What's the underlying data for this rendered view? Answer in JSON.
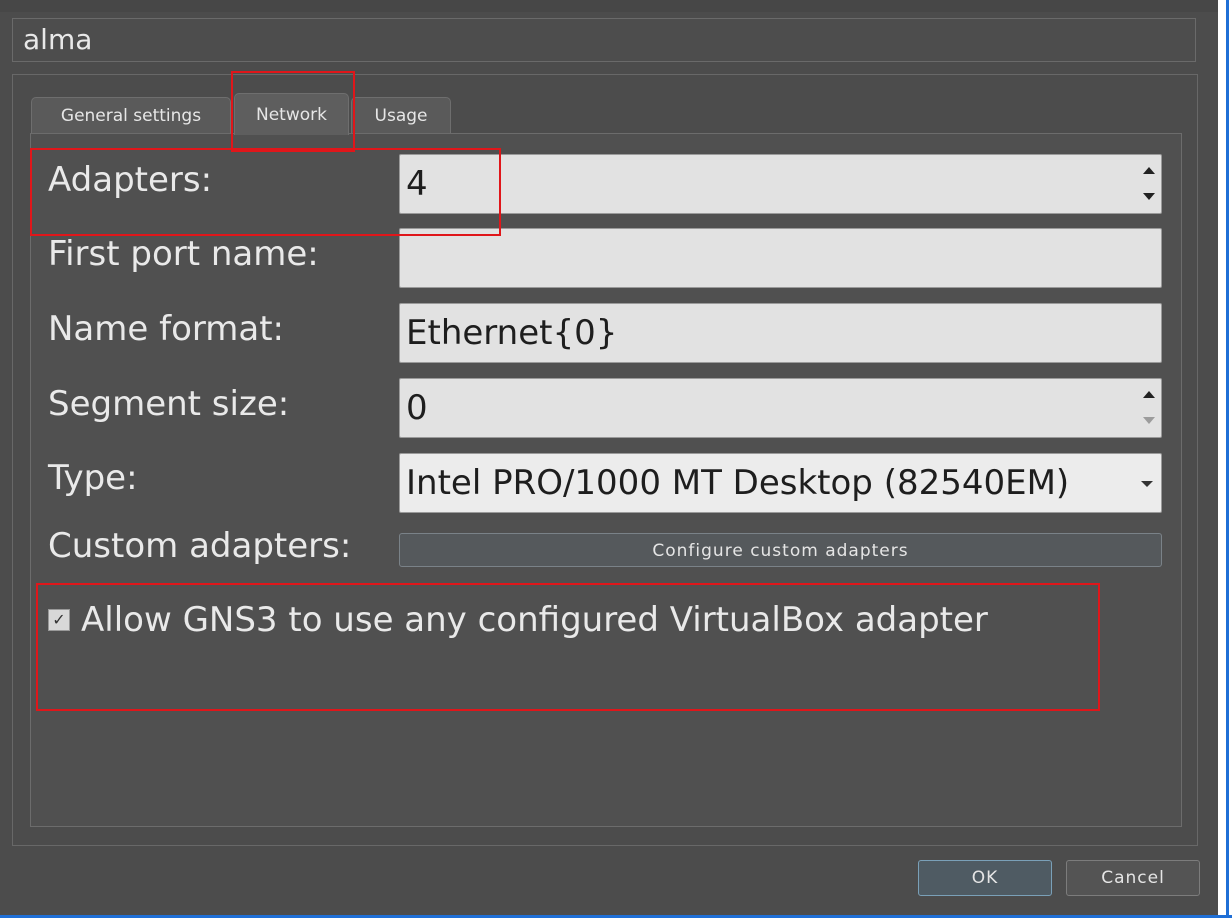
{
  "dialog": {
    "vm_name": "alma",
    "tabs": [
      {
        "label": "General settings",
        "active": false
      },
      {
        "label": "Network",
        "active": true
      },
      {
        "label": "Usage",
        "active": false
      }
    ],
    "network": {
      "adapters": {
        "label": "Adapters:",
        "value": "4"
      },
      "first_port_name": {
        "label": "First port name:",
        "value": ""
      },
      "name_format": {
        "label": "Name format:",
        "value": "Ethernet{0}"
      },
      "segment_size": {
        "label": "Segment size:",
        "value": "0"
      },
      "type": {
        "label": "Type:",
        "value": "Intel PRO/1000 MT Desktop (82540EM)"
      },
      "custom_adapters": {
        "label": "Custom adapters:",
        "button_label": "Configure custom adapters"
      },
      "allow_any_adapter": {
        "label": "Allow GNS3 to use any configured VirtualBox adapter",
        "checked": true,
        "check_glyph": "✓"
      }
    },
    "buttons": {
      "ok": "OK",
      "cancel": "Cancel"
    }
  },
  "colors": {
    "background": "#4c4c4c",
    "field_bg": "#e2e2e2",
    "highlight_red": "#e0161a",
    "accent_blue": "#1f6fd6"
  }
}
